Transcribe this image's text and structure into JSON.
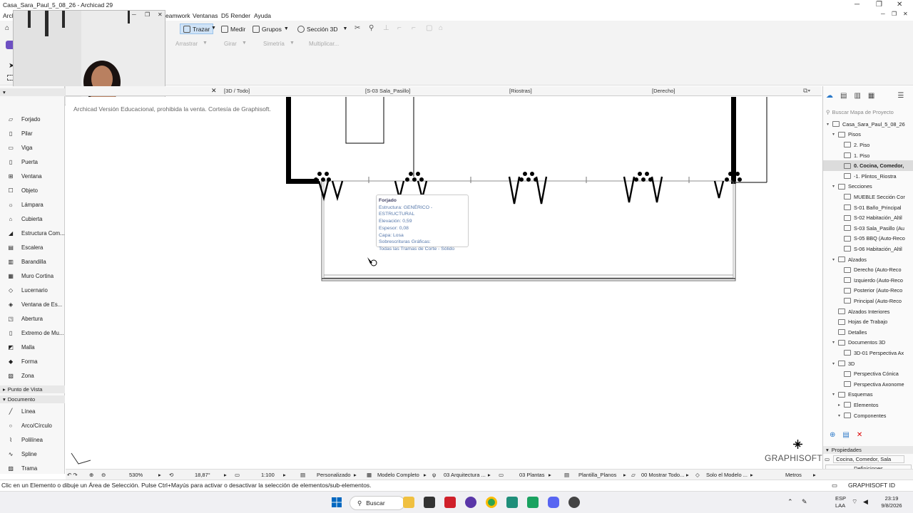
{
  "window": {
    "title": "Casa_Sara_Paul_5_08_26 - Archicad 29"
  },
  "menus": [
    "Arch",
    "eamwork",
    "Ventanas",
    "D5 Render",
    "Ayuda"
  ],
  "toolbar": {
    "trazar": "Trazar",
    "medir": "Medir",
    "grupos": "Grupos",
    "seccion3d": "Sección 3D",
    "arrastrar": "Arrastrar",
    "girar": "Girar",
    "simetria": "Simetría",
    "multiplicar": "Multiplicar..."
  },
  "tabs": [
    "[3D / Todo]",
    "[S-03 Sala_Pasillo]",
    "[Riostras]",
    "[Derecho]"
  ],
  "tools": [
    "Forjado",
    "Pilar",
    "Viga",
    "Puerta",
    "Ventana",
    "Objeto",
    "Lámpara",
    "Cubierta",
    "Estructura Com...",
    "Escalera",
    "Barandilla",
    "Muro Cortina",
    "Lucernario",
    "Ventana de Es...",
    "Abertura",
    "Extremo de Mu...",
    "Malla",
    "Forma",
    "Zona"
  ],
  "sections": {
    "punto_de_vista": "Punto de Vista",
    "documento": "Documento"
  },
  "doc_tools": [
    "Línea",
    "Arco/Círculo",
    "Polilínea",
    "Spline",
    "Trama"
  ],
  "canvas": {
    "edu_notice": "Archicad Versión Educacional, prohibida la venta. Cortesía de Graphisoft.",
    "tooltip": {
      "title": "Forjado",
      "lines": [
        "Estructura: GENÉRICO - ESTRUCTURAL",
        "Elevación: 0,59",
        "Espesor: 0,08",
        "Capa: Losa",
        "Sobrescrituras Gráficas:",
        "Todas las Tramas de Corte - Sólido"
      ]
    },
    "logo": "GRAPHISOFT"
  },
  "navigator": {
    "search_placeholder": "Buscar Mapa de Proyecto",
    "items": [
      {
        "label": "Casa_Sara_Paul_5_08_26",
        "indent": 0,
        "exp": "v"
      },
      {
        "label": "Pisos",
        "indent": 1,
        "exp": "v"
      },
      {
        "label": "2. Piso",
        "indent": 2,
        "exp": ""
      },
      {
        "label": "1. Piso",
        "indent": 2,
        "exp": ""
      },
      {
        "label": "0. Cocina, Comedor,",
        "indent": 2,
        "exp": "",
        "sel": true
      },
      {
        "label": "-1. Plintos_Riostra",
        "indent": 2,
        "exp": ""
      },
      {
        "label": "Secciones",
        "indent": 1,
        "exp": "v"
      },
      {
        "label": "MUEBLE Sección Cor",
        "indent": 2,
        "exp": ""
      },
      {
        "label": "S-01 Baño_Principal",
        "indent": 2,
        "exp": ""
      },
      {
        "label": "S-02 Habitación_Altil",
        "indent": 2,
        "exp": ""
      },
      {
        "label": "S-03 Sala_Pasillo (Au",
        "indent": 2,
        "exp": ""
      },
      {
        "label": "S-05 BBQ (Auto-Reco",
        "indent": 2,
        "exp": ""
      },
      {
        "label": "S-06 Habitación_Altil",
        "indent": 2,
        "exp": ""
      },
      {
        "label": "Alzados",
        "indent": 1,
        "exp": "v"
      },
      {
        "label": "Derecho (Auto-Reco",
        "indent": 2,
        "exp": ""
      },
      {
        "label": "Izquierdo (Auto-Reco",
        "indent": 2,
        "exp": ""
      },
      {
        "label": "Posterior (Auto-Reco",
        "indent": 2,
        "exp": ""
      },
      {
        "label": "Principal (Auto-Reco",
        "indent": 2,
        "exp": ""
      },
      {
        "label": "Alzados Interiores",
        "indent": 1,
        "exp": ""
      },
      {
        "label": "Hojas de Trabajo",
        "indent": 1,
        "exp": ""
      },
      {
        "label": "Detalles",
        "indent": 1,
        "exp": ""
      },
      {
        "label": "Documentos 3D",
        "indent": 1,
        "exp": "v"
      },
      {
        "label": "3D-01 Perspectiva Ax",
        "indent": 2,
        "exp": ""
      },
      {
        "label": "3D",
        "indent": 1,
        "exp": "v"
      },
      {
        "label": "Perspectiva Cónica",
        "indent": 2,
        "exp": ""
      },
      {
        "label": "Perspectiva Axonome",
        "indent": 2,
        "exp": ""
      },
      {
        "label": "Esquemas",
        "indent": 1,
        "exp": "v"
      },
      {
        "label": "Elementos",
        "indent": 2,
        "exp": ">"
      },
      {
        "label": "Componentes",
        "indent": 2,
        "exp": "v"
      }
    ],
    "properties": {
      "header": "Propiedades",
      "current": "Cocina, Comedor, Sala",
      "definitions": "Definiciones"
    }
  },
  "status": {
    "zoom": "530%",
    "angle": "18,87°",
    "scale": "1:100",
    "pen": "Personalizado",
    "model": "Modelo Completo",
    "layer": "03 Arquitectura ...",
    "plantas": "03 Plantas",
    "plantilla": "Plantilla_Planos",
    "mostrar": "00 Mostrar Todo...",
    "solo": "Solo el Modelo ...",
    "units": "Metros"
  },
  "message": "Clic en un Elemento o dibuje un Área de Selección. Pulse Ctrl+Mayús para activar o desactivar la selección de elementos/sub-elementos.",
  "graphisoft_id": "GRAPHISOFT ID",
  "taskbar": {
    "search": "Buscar",
    "lang": "ESP",
    "lang2": "LAA",
    "time": "23:19",
    "date": "9/8/2026"
  },
  "colors": {
    "accent": "#0067c0",
    "tooltip_text": "#5577aa"
  }
}
